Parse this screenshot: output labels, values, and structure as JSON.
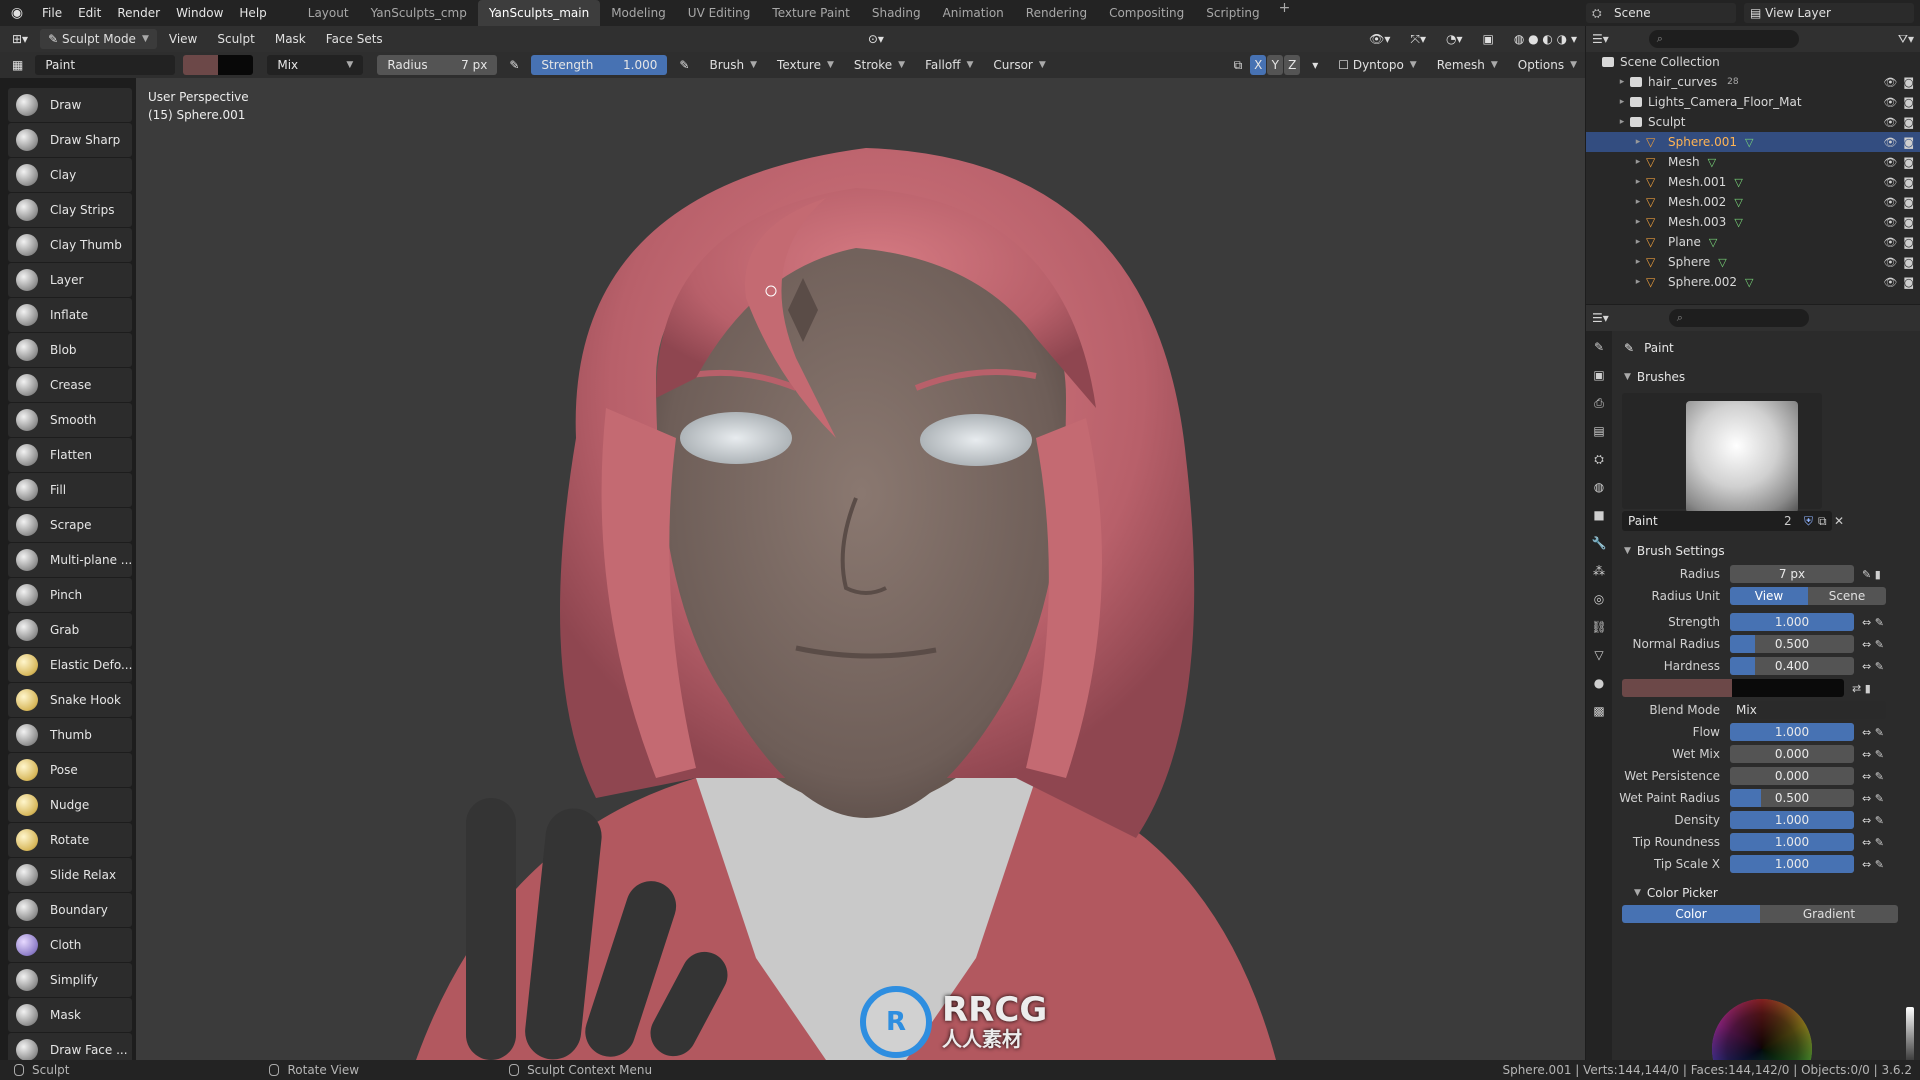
{
  "topbar": {
    "menus": [
      "File",
      "Edit",
      "Render",
      "Window",
      "Help"
    ],
    "workspaces": [
      "Layout",
      "YanSculpts_cmp",
      "YanSculpts_main",
      "Modeling",
      "UV Editing",
      "Texture Paint",
      "Shading",
      "Animation",
      "Rendering",
      "Compositing",
      "Scripting"
    ],
    "active_workspace": "YanSculpts_main",
    "scene": "Scene",
    "view_layer": "View Layer"
  },
  "header": {
    "mode": "Sculpt Mode",
    "menus": [
      "View",
      "Sculpt",
      "Mask",
      "Face Sets"
    ]
  },
  "toolrow": {
    "brush_name": "Paint",
    "blend": "Mix",
    "radius_label": "Radius",
    "radius_value": "7 px",
    "strength_label": "Strength",
    "strength_value": "1.000",
    "dropdowns": [
      "Brush",
      "Texture",
      "Stroke",
      "Falloff",
      "Cursor"
    ],
    "axes": [
      "X",
      "Y",
      "Z"
    ],
    "dyntopo": "Dyntopo",
    "remesh": "Remesh",
    "options": "Options"
  },
  "tools": [
    "Draw",
    "Draw Sharp",
    "Clay",
    "Clay Strips",
    "Clay Thumb",
    "Layer",
    "Inflate",
    "Blob",
    "Crease",
    "Smooth",
    "Flatten",
    "Fill",
    "Scrape",
    "Multi-plane ...",
    "Pinch",
    "Grab",
    "Elastic Defo...",
    "Snake Hook",
    "Thumb",
    "Pose",
    "Nudge",
    "Rotate",
    "Slide Relax",
    "Boundary",
    "Cloth",
    "Simplify",
    "Mask",
    "Draw Face ..."
  ],
  "viewport": {
    "line1": "User Perspective",
    "line2": "(15) Sphere.001"
  },
  "outliner": {
    "root": "Scene Collection",
    "rows": [
      {
        "name": "hair_curves",
        "type": "collection",
        "suffix": "28"
      },
      {
        "name": "Lights_Camera_Floor_Mat",
        "type": "collection",
        "suffix": ""
      },
      {
        "name": "Sculpt",
        "type": "collection",
        "suffix": ""
      },
      {
        "name": "Sphere.001",
        "type": "mesh",
        "selected": true
      },
      {
        "name": "Mesh",
        "type": "mesh"
      },
      {
        "name": "Mesh.001",
        "type": "mesh"
      },
      {
        "name": "Mesh.002",
        "type": "mesh"
      },
      {
        "name": "Mesh.003",
        "type": "mesh"
      },
      {
        "name": "Plane",
        "type": "mesh"
      },
      {
        "name": "Sphere",
        "type": "mesh"
      },
      {
        "name": "Sphere.002",
        "type": "mesh"
      }
    ]
  },
  "properties": {
    "title": "Paint",
    "brushes_panel": "Brushes",
    "brush_name": "Paint",
    "brush_users": "2",
    "settings_panel": "Brush Settings",
    "radius_label": "Radius",
    "radius_value": "7 px",
    "radius_unit_label": "Radius Unit",
    "radius_unit_options": [
      "View",
      "Scene"
    ],
    "radius_unit_selected": "View",
    "sliders": [
      {
        "label": "Strength",
        "value": "1.000",
        "fill": 1.0
      },
      {
        "label": "Normal Radius",
        "value": "0.500",
        "fill": 0.2
      },
      {
        "label": "Hardness",
        "value": "0.400",
        "fill": 0.2
      }
    ],
    "blend_label": "Blend Mode",
    "blend_value": "Mix",
    "sliders2": [
      {
        "label": "Flow",
        "value": "1.000",
        "fill": 1.0
      },
      {
        "label": "Wet Mix",
        "value": "0.000",
        "fill": 0.0
      },
      {
        "label": "Wet Persistence",
        "value": "0.000",
        "fill": 0.0
      },
      {
        "label": "Wet Paint Radius",
        "value": "0.500",
        "fill": 0.25
      },
      {
        "label": "Density",
        "value": "1.000",
        "fill": 1.0
      },
      {
        "label": "Tip Roundness",
        "value": "1.000",
        "fill": 1.0
      },
      {
        "label": "Tip Scale X",
        "value": "1.000",
        "fill": 1.0
      }
    ],
    "color_picker_panel": "Color Picker",
    "picker_tabs": [
      "Color",
      "Gradient"
    ],
    "picker_selected": "Color"
  },
  "statusbar": {
    "left": "Sculpt",
    "mid1": "Rotate View",
    "mid2": "Sculpt Context Menu",
    "right": "Sphere.001 | Verts:144,144/0 | Faces:144,142/0 | Objects:0/0 | 3.6.2"
  },
  "watermark": {
    "mark": "R",
    "title": "RRCG",
    "subtitle": "人人素材"
  },
  "colors": {
    "accent": "#4772b3",
    "hair": "#c46a72",
    "skin": "#7a6a62",
    "primary_paint": "#6c4848",
    "secondary_paint": "#080808"
  }
}
